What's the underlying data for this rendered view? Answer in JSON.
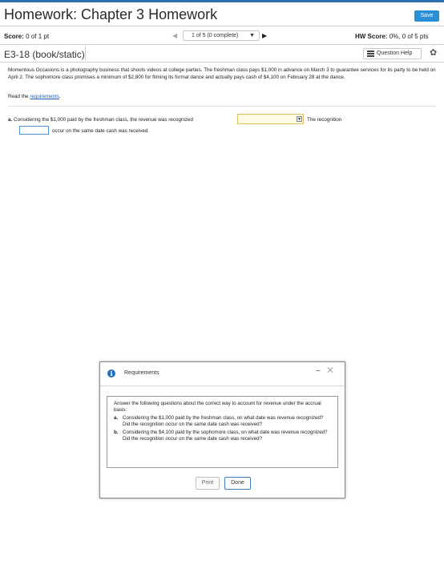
{
  "header": {
    "title": "Homework: Chapter 3 Homework",
    "save_label": "Save"
  },
  "status_bar": {
    "score_label": "Score:",
    "score_value": "0 of 1 pt",
    "nav_position": "1 of 5 (0 complete)",
    "hw_score_label": "HW Score:",
    "hw_score_value": "0%, 0 of 5 pts"
  },
  "question": {
    "id": "E3-18 (book/static)",
    "help_label": "Question Help",
    "problem_text": "Momentous Occasions is a photography business that shoots videos at college parties. The freshman class pays $1,000 in advance on March 3 to guarantee services for its party to be held on April 2. The sophomore class promises a minimum of $2,800 for filming its formal dance and actually pays cash of $4,100 on February 28 at the dance.",
    "read_prefix": "Read the",
    "requirements_link": "requirements",
    "read_suffix": ".",
    "part_a": {
      "letter": "a.",
      "text": "Considering the $1,000 paid by the freshman class, the revenue was recognized",
      "after_dropdown": "The recognition",
      "after_blank": "occur on the same date cash was received."
    }
  },
  "modal": {
    "title": "Requirements",
    "intro": "Answer the following questions about the correct way to account for revenue under the accrual basis:",
    "items": [
      {
        "letter": "a.",
        "text": "Considering the $1,000 paid by the freshman class, on what date was revenue recognized? Did the recognition occur on the same date cash was received?"
      },
      {
        "letter": "b.",
        "text": "Considering the $4,100 paid by the sophomore class, on what date was revenue recognized? Did the recognition occur on the same date cash was received?"
      }
    ],
    "print_label": "Print",
    "done_label": "Done"
  },
  "colors": {
    "accent": "#2b8fd6",
    "input_highlight": "#e3c15c",
    "info_icon": "#1e6fc2"
  },
  "icons": [
    "prev-arrow-icon",
    "next-arrow-icon",
    "dropdown-caret-icon",
    "list-icon",
    "gear-icon",
    "info-icon",
    "minimize-icon",
    "close-icon"
  ]
}
